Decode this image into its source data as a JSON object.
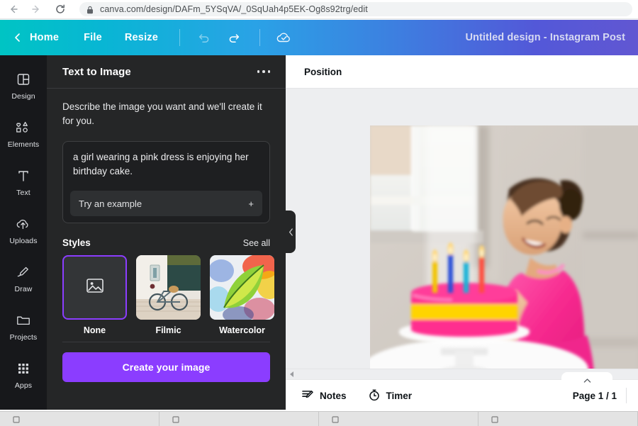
{
  "browser": {
    "url": "canva.com/design/DAFm_5YSqVA/_0SqUah4p5EK-Og8s92trg/edit",
    "back_icon": "back-arrow-icon",
    "forward_icon": "forward-arrow-icon",
    "reload_icon": "reload-icon",
    "lock_icon": "lock-icon"
  },
  "topbar": {
    "back_icon": "chevron-left-icon",
    "home": "Home",
    "file": "File",
    "resize": "Resize",
    "undo_icon": "undo-icon",
    "redo_icon": "redo-icon",
    "save_icon": "cloud-check-icon",
    "design_title": "Untitled design - Instagram Post",
    "gradient_start": "#00c4c4",
    "gradient_end": "#6157d2"
  },
  "sidebar": {
    "items": [
      {
        "label": "Design",
        "icon": "design-layout-icon"
      },
      {
        "label": "Elements",
        "icon": "shapes-icon"
      },
      {
        "label": "Text",
        "icon": "text-t-icon"
      },
      {
        "label": "Uploads",
        "icon": "cloud-upload-icon"
      },
      {
        "label": "Draw",
        "icon": "pen-draw-icon"
      },
      {
        "label": "Projects",
        "icon": "folder-icon"
      },
      {
        "label": "Apps",
        "icon": "grid-apps-icon"
      }
    ]
  },
  "panel": {
    "title": "Text to Image",
    "menu_icon": "more-options-icon",
    "description": "Describe the image you want and we'll create it for you.",
    "prompt_value": "a girl wearing a pink dress is enjoying her birthday cake.",
    "prompt_placeholder": "Describe the image you want",
    "try_example_label": "Try an example",
    "try_example_icon": "plus-icon",
    "styles_title": "Styles",
    "see_all_label": "See all",
    "styles": [
      {
        "label": "None",
        "selected": true,
        "icon": "image-placeholder-icon"
      },
      {
        "label": "Filmic",
        "selected": false,
        "icon": "bicycle-photo-thumbnail"
      },
      {
        "label": "Watercolor",
        "selected": false,
        "icon": "leaf-watercolor-thumbnail"
      }
    ],
    "create_label": "Create your image",
    "accent_color": "#8b3dff",
    "collapse_icon": "chevron-left-icon"
  },
  "editor": {
    "position_label": "Position",
    "canvas_alt": "girl in pink dress with birthday cake",
    "scroll_left_icon": "triangle-left-icon",
    "notes_label": "Notes",
    "notes_icon": "notes-icon",
    "timer_label": "Timer",
    "timer_icon": "stopwatch-icon",
    "page_indicator": "Page 1 / 1",
    "expand_icon": "chevron-up-icon"
  },
  "taskbar": {
    "items": [
      {
        "icon": "window-icon"
      },
      {
        "icon": "window-icon"
      },
      {
        "icon": "window-icon"
      },
      {
        "icon": "window-icon"
      }
    ]
  }
}
